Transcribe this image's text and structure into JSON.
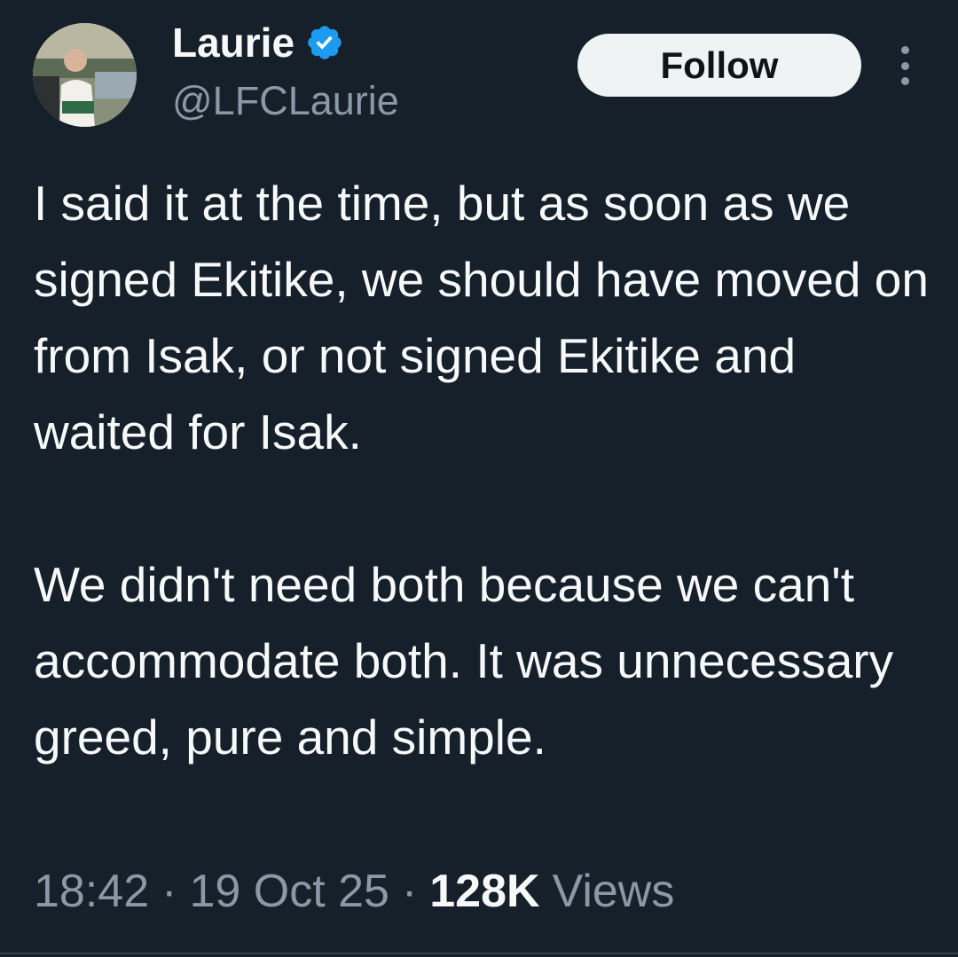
{
  "tweet": {
    "author": {
      "display_name": "Laurie",
      "handle": "@LFCLaurie",
      "verified": true,
      "avatar_icon": "profile-photo"
    },
    "follow_label": "Follow",
    "more_icon": "more-vertical-icon",
    "paragraphs": [
      "I said it at the time, but as soon as we signed Ekitike, we should have moved on from Isak, or not signed Ekitike and waited for Isak.",
      "We didn't need both because we can't accommodate both. It was unnecessary greed, pure and simple."
    ],
    "meta": {
      "time": "18:42",
      "separator": "·",
      "date": "19 Oct 25",
      "views_count": "128K",
      "views_label": "Views"
    }
  },
  "colors": {
    "background": "#15202b",
    "text_primary": "#f7f9f9",
    "text_secondary": "#8b98a5",
    "verified_blue": "#1d9bf0",
    "follow_bg": "#eff3f4"
  }
}
